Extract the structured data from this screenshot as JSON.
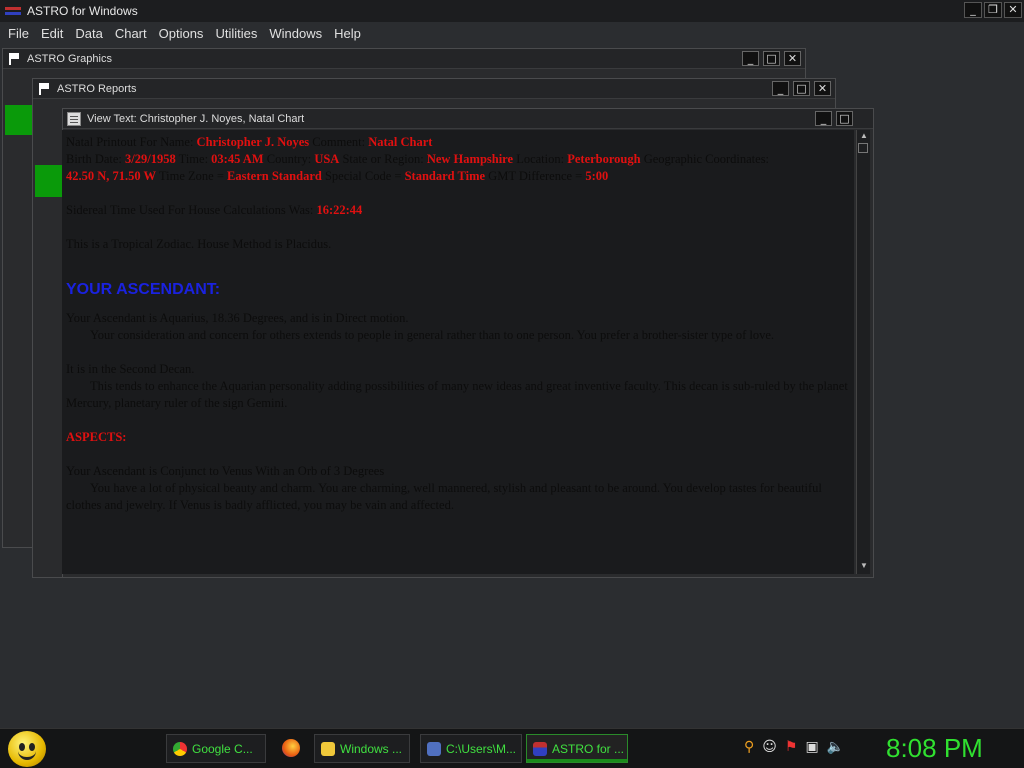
{
  "app": {
    "title": "ASTRO for Windows"
  },
  "window_controls": {
    "minimize": "_",
    "restore": "❐",
    "close": "✕"
  },
  "menu": [
    "File",
    "Edit",
    "Data",
    "Chart",
    "Options",
    "Utilities",
    "Windows",
    "Help"
  ],
  "windows": {
    "graphics": {
      "title": "ASTRO Graphics"
    },
    "reports": {
      "title": "ASTRO Reports"
    },
    "viewer": {
      "title": "View Text: Christopher J. Noyes, Natal Chart"
    }
  },
  "report": {
    "line1": {
      "l_name": "Natal Printout For Name:",
      "name": "Christopher J. Noyes",
      "l_comment": "Comment:",
      "comment": "Natal Chart"
    },
    "line2": {
      "l_birth": "Birth Date:",
      "birth": "3/29/1958",
      "l_time": "Time:",
      "time": "03:45 AM",
      "l_country": "Country:",
      "country": "USA",
      "l_state": "State or Region:",
      "state": "New Hampshire",
      "l_location": "Location:",
      "location": "Peterborough",
      "l_coords": "Geographic Coordinates:"
    },
    "line3": {
      "coords": "42.50 N, 71.50 W",
      "l_tz": "Time Zone =",
      "tz": "Eastern Standard",
      "l_special": "Special Code =",
      "special": "Standard Time",
      "l_gmt": "GMT Difference =",
      "gmt": "5:00"
    },
    "sidereal": {
      "label": "Sidereal Time Used For House Calculations Was:",
      "value": "16:22:44"
    },
    "zodiac": "This is a Tropical Zodiac. House Method is Placidus.",
    "heading": "YOUR ASCENDANT:",
    "asc1": "Your Ascendant is Aquarius, 18.36 Degrees, and is in Direct motion.",
    "asc1_detail": "Your consideration and concern for others extends to people in general rather than to one person. You prefer a brother-sister type of love.",
    "decan": "It is in the Second Decan.",
    "decan_detail": "This tends to enhance the Aquarian personality adding possibilities of many new ideas and great inventive faculty. This decan is sub-ruled by the planet Mercury, planetary ruler of the sign Gemini.",
    "aspects_heading": "ASPECTS:",
    "conj": "Your Ascendant is Conjunct to Venus With an Orb of 3 Degrees",
    "conj_detail": "You have a lot of physical beauty and charm. You are charming, well mannered, stylish and pleasant to be around. You develop tastes for beautiful clothes and jewelry. If Venus is badly afflicted, you may be vain and affected."
  },
  "taskbar": {
    "tasks": [
      {
        "label": "Google C...",
        "icon": "chrome-icon"
      },
      {
        "label": "Windows ...",
        "icon": "folder-icon"
      },
      {
        "label": "C:\\Users\\M...",
        "icon": "cmd-icon"
      },
      {
        "label": "ASTRO for ...",
        "icon": "astro-icon"
      }
    ],
    "clock": "8:08 PM"
  }
}
